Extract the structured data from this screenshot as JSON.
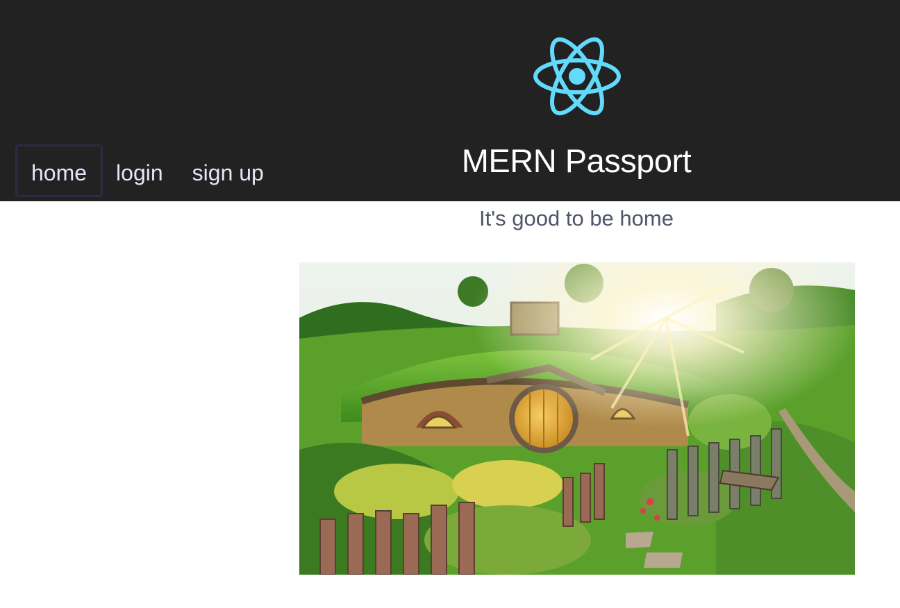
{
  "app": {
    "title": "MERN Passport",
    "logo_icon": "react-atom-icon",
    "logo_color": "#61dafb",
    "header_bg": "#222222"
  },
  "nav": {
    "items": [
      {
        "label": "home",
        "active": true
      },
      {
        "label": "login",
        "active": false
      },
      {
        "label": "sign up",
        "active": false
      }
    ]
  },
  "main": {
    "tagline": "It's good to be home",
    "hero_image": "hobbit-hole-image"
  }
}
